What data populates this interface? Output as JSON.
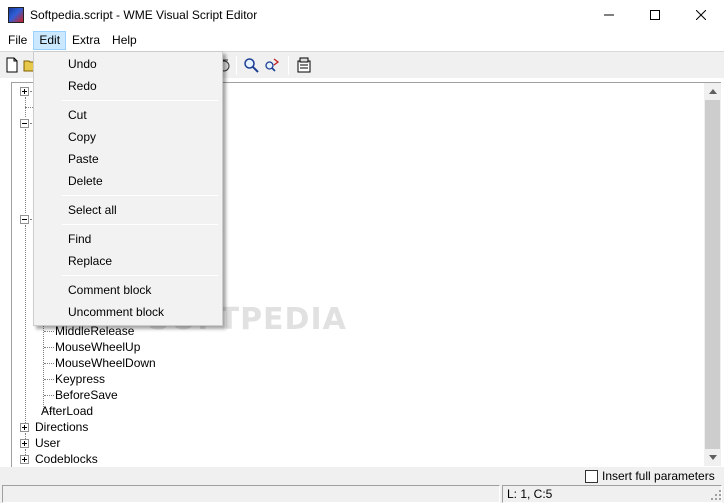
{
  "window": {
    "title": "Softpedia.script - WME Visual Script Editor"
  },
  "menubar": {
    "items": [
      {
        "label": "File"
      },
      {
        "label": "Edit"
      },
      {
        "label": "Extra"
      },
      {
        "label": "Help"
      }
    ],
    "active": "Edit"
  },
  "edit_menu": {
    "items": [
      {
        "label": "Undo"
      },
      {
        "label": "Redo"
      },
      {
        "label": "Cut"
      },
      {
        "label": "Copy"
      },
      {
        "label": "Paste"
      },
      {
        "label": "Delete"
      },
      {
        "label": "Select all"
      },
      {
        "label": "Find"
      },
      {
        "label": "Replace"
      },
      {
        "label": "Comment block"
      },
      {
        "label": "Uncomment block"
      }
    ]
  },
  "tree": {
    "event_children": [
      "MiddleRelease",
      "MouseWheelUp",
      "MouseWheelDown",
      "Keypress",
      "BeforeSave",
      "AfterLoad"
    ],
    "top_nodes": [
      "Directions",
      "User",
      "Codeblocks"
    ]
  },
  "watermark": "SOFTPEDIA",
  "options": {
    "insert_full_parameters_label": "Insert full parameters",
    "insert_full_parameters_checked": false
  },
  "status": {
    "position": "L: 1, C:5"
  },
  "colors": {
    "menu_highlight": "#cce8ff",
    "toolbar_bg": "#f0f0f0",
    "dropdown_bg": "#f2f2f2"
  }
}
